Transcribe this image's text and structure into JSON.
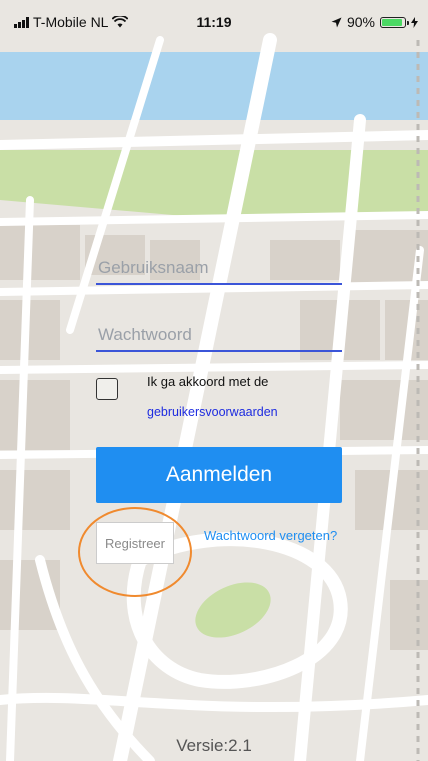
{
  "status_bar": {
    "carrier": "T-Mobile NL",
    "time": "11:19",
    "battery": "90%",
    "battery_level": 0.9,
    "icons": [
      "signal-icon",
      "wifi-icon",
      "location-arrow-icon",
      "battery-icon",
      "charging-icon"
    ]
  },
  "login": {
    "username_placeholder": "Gebruiksnaam",
    "username_value": "",
    "password_placeholder": "Wachtwoord",
    "password_value": "",
    "agree_text": "Ik ga akkoord met de",
    "terms_link": "gebruikersvoorwaarden",
    "login_button": "Aanmelden",
    "register_button": "Registreer",
    "forgot_password": "Wachtwoord vergeten?"
  },
  "footer": {
    "version": "Versie:2.1"
  },
  "colors": {
    "primary_button": "#1f8ef1",
    "input_underline": "#3b55d8",
    "link": "#1d2be0",
    "annotation_circle": "#f08a2e",
    "map_background": "#e9e6e1",
    "water": "#a9d3ee",
    "park": "#c9dfa6"
  }
}
